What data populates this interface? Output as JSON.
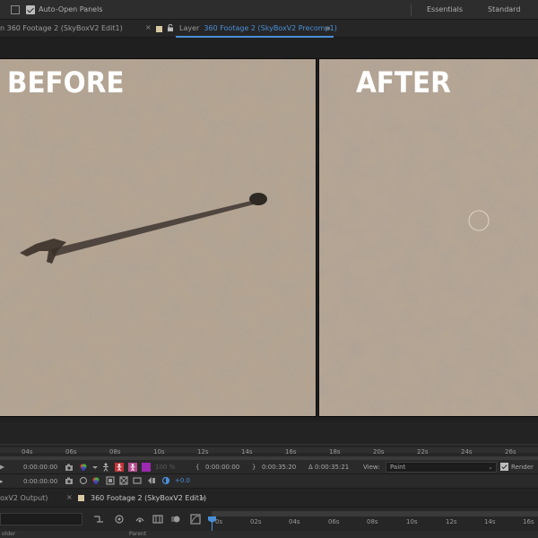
{
  "appbar": {
    "auto_open_label": "Auto-Open Panels",
    "workspaces": [
      "Essentials",
      "Standard"
    ]
  },
  "tabs": {
    "left_tab": "n 360 Footage 2 (SkyBoxV2 Edit1)",
    "layer_prefix": "Layer",
    "layer_name": "360 Footage 2 (SkyBoxV2 Precomp1)"
  },
  "viewer": {
    "before_label": "BEFORE",
    "after_label": "AFTER"
  },
  "ruler": {
    "ticks": [
      "04s",
      "06s",
      "08s",
      "10s",
      "12s",
      "14s",
      "16s",
      "18s",
      "20s",
      "22s",
      "24s",
      "26s"
    ]
  },
  "controls": {
    "timecode": "0:00:00:00",
    "zoom": "100 %",
    "in_point": "0:00:00:00",
    "out_point": "0:00:35:20",
    "duration": "Δ 0:00:35:21",
    "view_label": "View:",
    "view_value": "Paint",
    "exposure": "+0.0",
    "render_label": "Render"
  },
  "bottom_tabs": {
    "left_tab": "oxV2 Output)",
    "active_tab": "360 Footage 2 (SkyBoxV2 Edit1)"
  },
  "timeline": {
    "ticks": [
      "0s",
      "02s",
      "04s",
      "06s",
      "08s",
      "10s",
      "12s",
      "14s",
      "16s"
    ],
    "row_left": "older",
    "row_right": "Parent"
  },
  "colors": {
    "accent": "#4a8fd8",
    "label_swatch": "#d8c9a3"
  }
}
